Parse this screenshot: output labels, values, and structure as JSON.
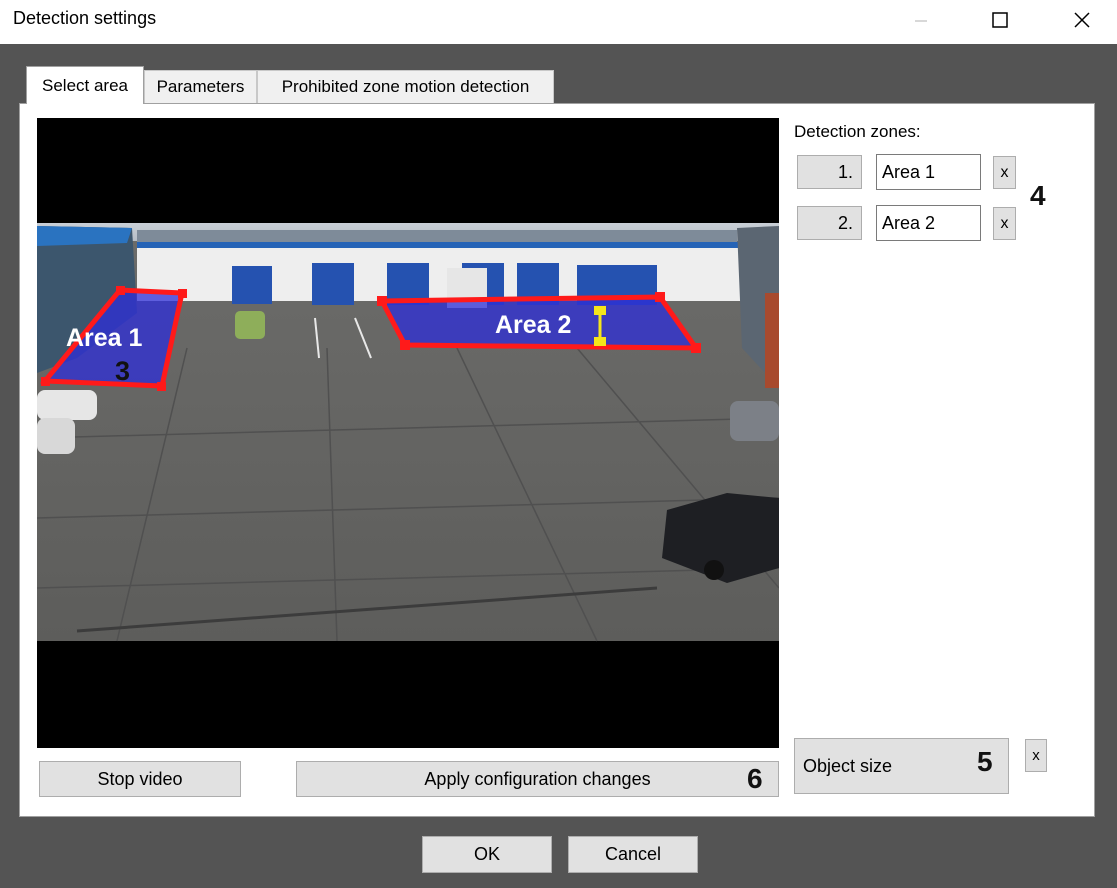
{
  "window": {
    "title": "Detection settings"
  },
  "tabs": [
    {
      "label": "Select area"
    },
    {
      "label": "Parameters"
    },
    {
      "label": "Prohibited zone motion detection"
    }
  ],
  "zones": {
    "label": "Detection zones:",
    "items": [
      {
        "number": "1.",
        "name": "Area 1",
        "remove": "x"
      },
      {
        "number": "2.",
        "name": "Area 2",
        "remove": "x"
      }
    ]
  },
  "video": {
    "area1_label": "Area 1",
    "area2_label": "Area 2",
    "zone_color": "#2e2ed8",
    "outline_color": "#ff1a1a",
    "handle_color": "#f5e61a"
  },
  "object_size": {
    "label": "Object size",
    "remove": "x"
  },
  "buttons": {
    "stop_video": "Stop video",
    "apply": "Apply configuration changes",
    "ok": "OK",
    "cancel": "Cancel"
  },
  "callouts": {
    "c3": "3",
    "c4": "4",
    "c5": "5",
    "c6": "6"
  },
  "icons": {
    "minimize": "minimize-icon",
    "maximize": "maximize-icon",
    "close": "close-icon"
  }
}
